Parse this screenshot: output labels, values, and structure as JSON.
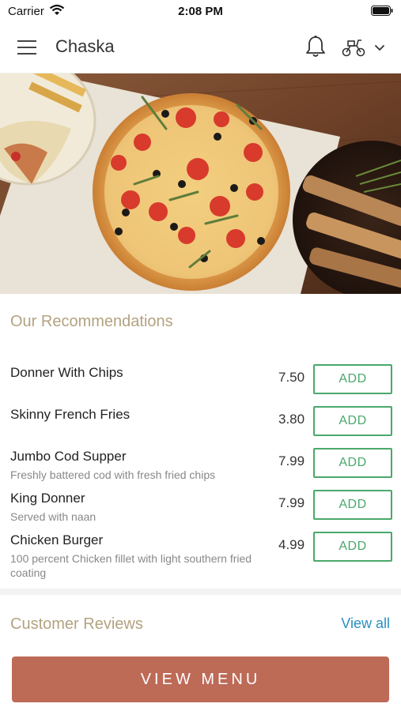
{
  "status_bar": {
    "carrier": "Carrier",
    "time": "2:08 PM"
  },
  "header": {
    "title": "Chaska"
  },
  "recommendations": {
    "heading": "Our Recommendations",
    "items": [
      {
        "name": "Donner With Chips",
        "description": "",
        "price": "7.50",
        "button": "ADD"
      },
      {
        "name": "Skinny French Fries",
        "description": "",
        "price": "3.80",
        "button": "ADD"
      },
      {
        "name": "Jumbo Cod Supper",
        "description": "Freshly battered cod with fresh fried chips",
        "price": "7.99",
        "button": "ADD"
      },
      {
        "name": "King Donner",
        "description": "Served with naan",
        "price": "7.99",
        "button": "ADD"
      },
      {
        "name": "Chicken Burger",
        "description": "100 percent Chicken fillet with light southern fried coating",
        "price": "4.99",
        "button": "ADD"
      }
    ]
  },
  "reviews": {
    "heading": "Customer Reviews",
    "link": "View all"
  },
  "footer": {
    "button": "VIEW MENU"
  },
  "icons": [
    "wifi-icon",
    "battery-icon",
    "menu-icon",
    "bell-icon",
    "scooter-icon",
    "chevron-down-icon"
  ],
  "colors": {
    "accent_green": "#4aa86b",
    "heading_tan": "#b3a281",
    "menu_button": "#bd6a57",
    "link_blue": "#2a8fc1"
  }
}
